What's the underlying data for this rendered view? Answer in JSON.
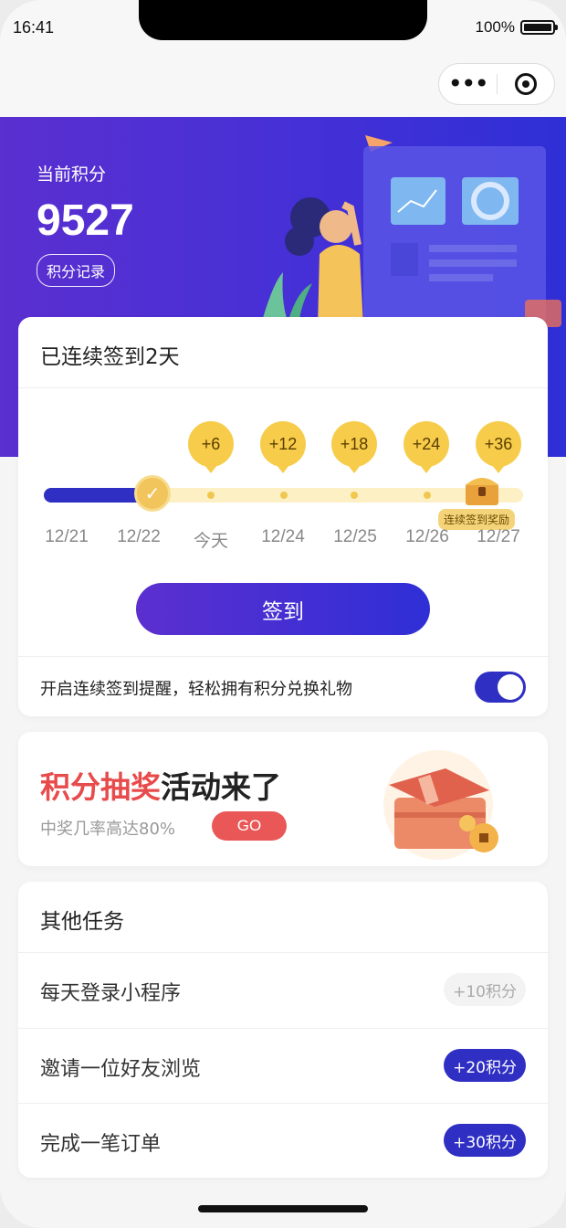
{
  "status_bar": {
    "time": "16:41",
    "battery": "100%"
  },
  "hero": {
    "label": "当前积分",
    "points": "9527",
    "record_button": "积分记录"
  },
  "checkin": {
    "title": "已连续签到2天",
    "bonuses": [
      "+6",
      "+12",
      "+18",
      "+24",
      "+36"
    ],
    "dates": [
      "12/21",
      "12/22",
      "今天",
      "12/24",
      "12/25",
      "12/26",
      "12/27"
    ],
    "reward_tag": "连续签到奖励",
    "sign_button": "签到",
    "reminder_text": "开启连续签到提醒，轻松拥有积分兑换礼物",
    "reminder_on": true
  },
  "lottery": {
    "headline_highlight": "积分抽奖",
    "headline_rest": "活动来了",
    "subtitle": "中奖几率高达80%",
    "go_button": "GO"
  },
  "tasks": {
    "title": "其他任务",
    "items": [
      {
        "name": "每天登录小程序",
        "reward": "+10积分",
        "done": true
      },
      {
        "name": "邀请一位好友浏览",
        "reward": "+20积分",
        "done": false
      },
      {
        "name": "完成一笔订单",
        "reward": "+30积分",
        "done": false
      }
    ]
  },
  "colors": {
    "primary": "#2f2fc4",
    "accent_red": "#e84b4b",
    "gold": "#f7cc4a"
  }
}
